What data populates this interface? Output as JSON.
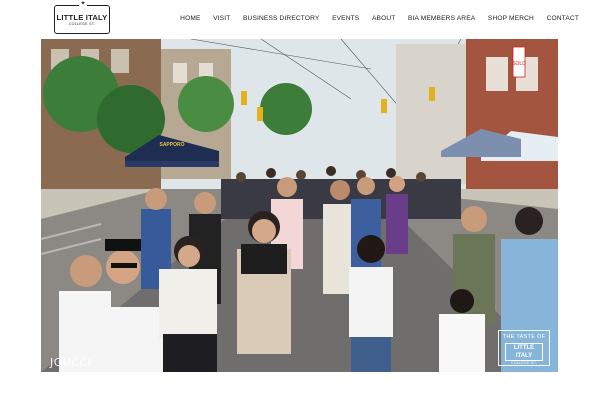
{
  "logo": {
    "crest": "✦",
    "main": "LITTLE ITALY",
    "sub": "COLLEGE ST."
  },
  "nav": [
    {
      "id": "home",
      "label": "HOME"
    },
    {
      "id": "visit",
      "label": "VISIT"
    },
    {
      "id": "business-directory",
      "label": "BUSINESS DIRECTORY"
    },
    {
      "id": "events",
      "label": "EVENTS"
    },
    {
      "id": "about",
      "label": "ABOUT"
    },
    {
      "id": "bia-members-area",
      "label": "BIA MEMBERS AREA"
    },
    {
      "id": "shop-merch",
      "label": "SHOP MERCH"
    },
    {
      "id": "contact",
      "label": "CONTACT"
    }
  ],
  "hero": {
    "watermark": "JGUCCI",
    "tent_text": "SAPPORO",
    "sign_text": "SOLD",
    "badge": {
      "top": "THE TASTE OF",
      "main": "LITTLE ITALY",
      "sub": "COLLEGE ST."
    }
  },
  "colors": {
    "sky": "#dfe6ea",
    "street": "#6f6e6c",
    "tent_navy": "#1f2d52",
    "tree_green": "#3d7d3a"
  }
}
